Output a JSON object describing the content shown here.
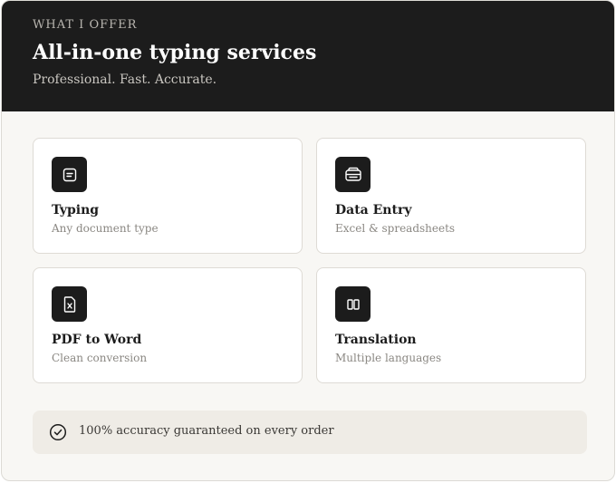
{
  "header": {
    "eyebrow": "WHAT I OFFER",
    "title": "All-in-one typing services",
    "subtitle": "Professional. Fast. Accurate."
  },
  "services": [
    {
      "title": "Typing",
      "description": "Any document type",
      "icon": "document-icon"
    },
    {
      "title": "Data Entry",
      "description": "Excel & spreadsheets",
      "icon": "database-icon"
    },
    {
      "title": "PDF to Word",
      "description": "Clean conversion",
      "icon": "file-convert-icon"
    },
    {
      "title": "Translation",
      "description": "Multiple languages",
      "icon": "columns-icon"
    }
  ],
  "guarantee": {
    "text": "100% accuracy guaranteed on every order",
    "icon": "check-circle-icon"
  },
  "colors": {
    "header_bg": "#1c1c1c",
    "card_bg": "#f8f7f4",
    "guarantee_bg": "#efece6"
  }
}
